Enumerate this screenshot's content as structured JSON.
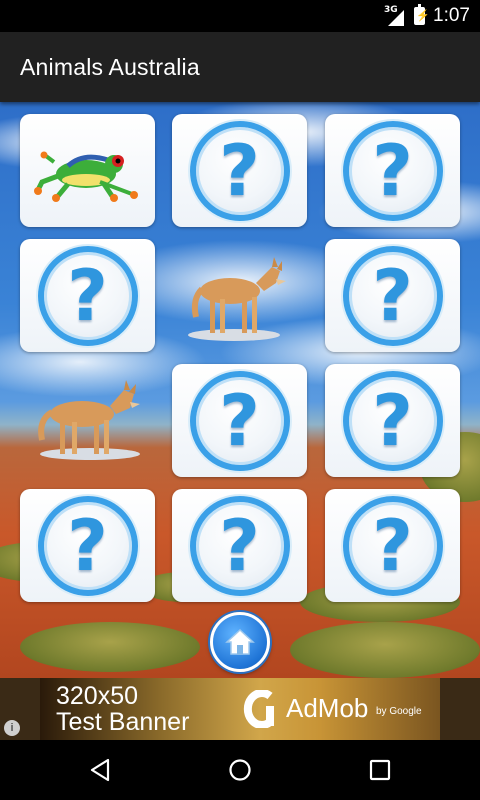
{
  "status_bar": {
    "network": "3G",
    "time": "1:07"
  },
  "action_bar": {
    "title": "Animals Australia"
  },
  "grid": {
    "tiles": [
      {
        "state": "revealed",
        "animal": "red-eyed tree frog"
      },
      {
        "state": "hidden",
        "symbol": "?"
      },
      {
        "state": "hidden",
        "symbol": "?"
      },
      {
        "state": "hidden",
        "symbol": "?"
      },
      {
        "state": "revealed",
        "animal": "dingo"
      },
      {
        "state": "hidden",
        "symbol": "?"
      },
      {
        "state": "revealed",
        "animal": "dingo"
      },
      {
        "state": "hidden",
        "symbol": "?"
      },
      {
        "state": "hidden",
        "symbol": "?"
      },
      {
        "state": "hidden",
        "symbol": "?"
      },
      {
        "state": "hidden",
        "symbol": "?"
      },
      {
        "state": "hidden",
        "symbol": "?"
      }
    ]
  },
  "home_button": {
    "icon": "home-icon"
  },
  "ad": {
    "info_symbol": "i",
    "line1": "320x50",
    "line2": "Test Banner",
    "brand": "AdMob",
    "byline": "by Google"
  },
  "nav": {
    "back_icon": "back-icon",
    "home_icon": "home-circle-icon",
    "recents_icon": "recents-icon"
  },
  "colors": {
    "action_bar": "#212121",
    "question_blue": "#2f96de",
    "home_button": "#1f74d6"
  }
}
